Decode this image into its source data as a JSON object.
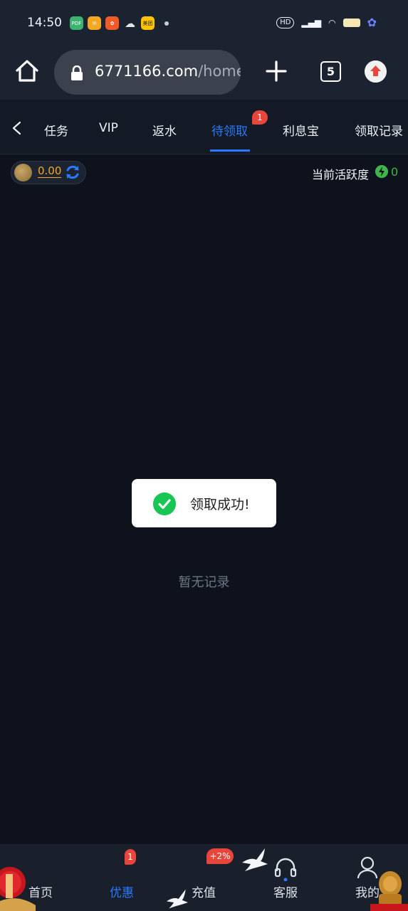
{
  "status_bar": {
    "time": "14:50",
    "apps": [
      {
        "name": "pdf-app-icon",
        "label": "PDF",
        "color": "#3cb371"
      },
      {
        "name": "mail-app-icon",
        "label": "",
        "color": "#f5a623"
      },
      {
        "name": "orange-app-icon",
        "label": "",
        "color": "#f0592a"
      },
      {
        "name": "wechat-icon",
        "label": "",
        "color": "#1b2331"
      },
      {
        "name": "meituan-icon",
        "label": "美团",
        "color": "#ffc300"
      }
    ],
    "hd_label": "HD"
  },
  "browser": {
    "url_domain": "6771166.com",
    "url_path": "/home/c",
    "tab_count": "5"
  },
  "tabs": {
    "items": [
      "任务",
      "VIP",
      "返水",
      "待领取",
      "利息宝",
      "领取记录"
    ],
    "active_index": 3,
    "badge": "1"
  },
  "balance": {
    "value": "0.00"
  },
  "activity": {
    "label": "当前活跃度",
    "value": "0"
  },
  "toast": {
    "message": "领取成功!"
  },
  "empty_state": "暂无记录",
  "bottom_nav": {
    "items": [
      "首页",
      "优惠",
      "充值",
      "客服",
      "我的"
    ],
    "active_index": 1,
    "promo_badge": "1",
    "recharge_badge": "+2%"
  },
  "colors": {
    "accent": "#2a7bff",
    "badge": "#e8453c",
    "balance": "#f5a623",
    "success": "#17c653",
    "activity": "#3fb54a"
  }
}
